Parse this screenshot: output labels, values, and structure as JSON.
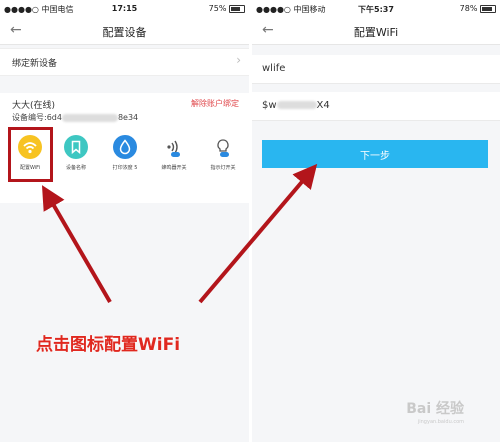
{
  "left_screen": {
    "status_bar": {
      "carrier": "●●●●○ 中国电信 ",
      "time": "17:15",
      "battery": "75%"
    },
    "title": "配置设备",
    "bind_new_device": "绑定新设备",
    "device": {
      "name": "大大(在线)",
      "unbind_label": "解除账户绑定",
      "serial_prefix": "设备编号:6d4",
      "serial_suffix": "8e34"
    },
    "icons": [
      {
        "label": "配置WiFi",
        "icon": "wifi-icon",
        "color": "#f7c322"
      },
      {
        "label": "设备名称",
        "icon": "bookmark-icon",
        "color": "#3ec7c2"
      },
      {
        "label": "打印浓度 5",
        "icon": "droplet-icon",
        "color": "#2a8ae0"
      },
      {
        "label": "蜂鸣器开关",
        "icon": "speaker-icon",
        "color": "#ffffff"
      },
      {
        "label": "指示灯开关",
        "icon": "bulb-icon",
        "color": "#ffffff"
      }
    ]
  },
  "right_screen": {
    "status_bar": {
      "carrier": "●●●●○ 中国移动 ",
      "time": "下午5:37",
      "battery": "78%"
    },
    "title": "配置WiFi",
    "ssid": "wlife",
    "password_prefix": "$w",
    "password_suffix": "X4",
    "next_button": "下一步"
  },
  "annotation": {
    "callout": "点击图标配置WiFi",
    "arrow_color": "#b3151b"
  },
  "watermark": {
    "text": "Bai 经验",
    "sub": "jingyan.baidu.com"
  }
}
